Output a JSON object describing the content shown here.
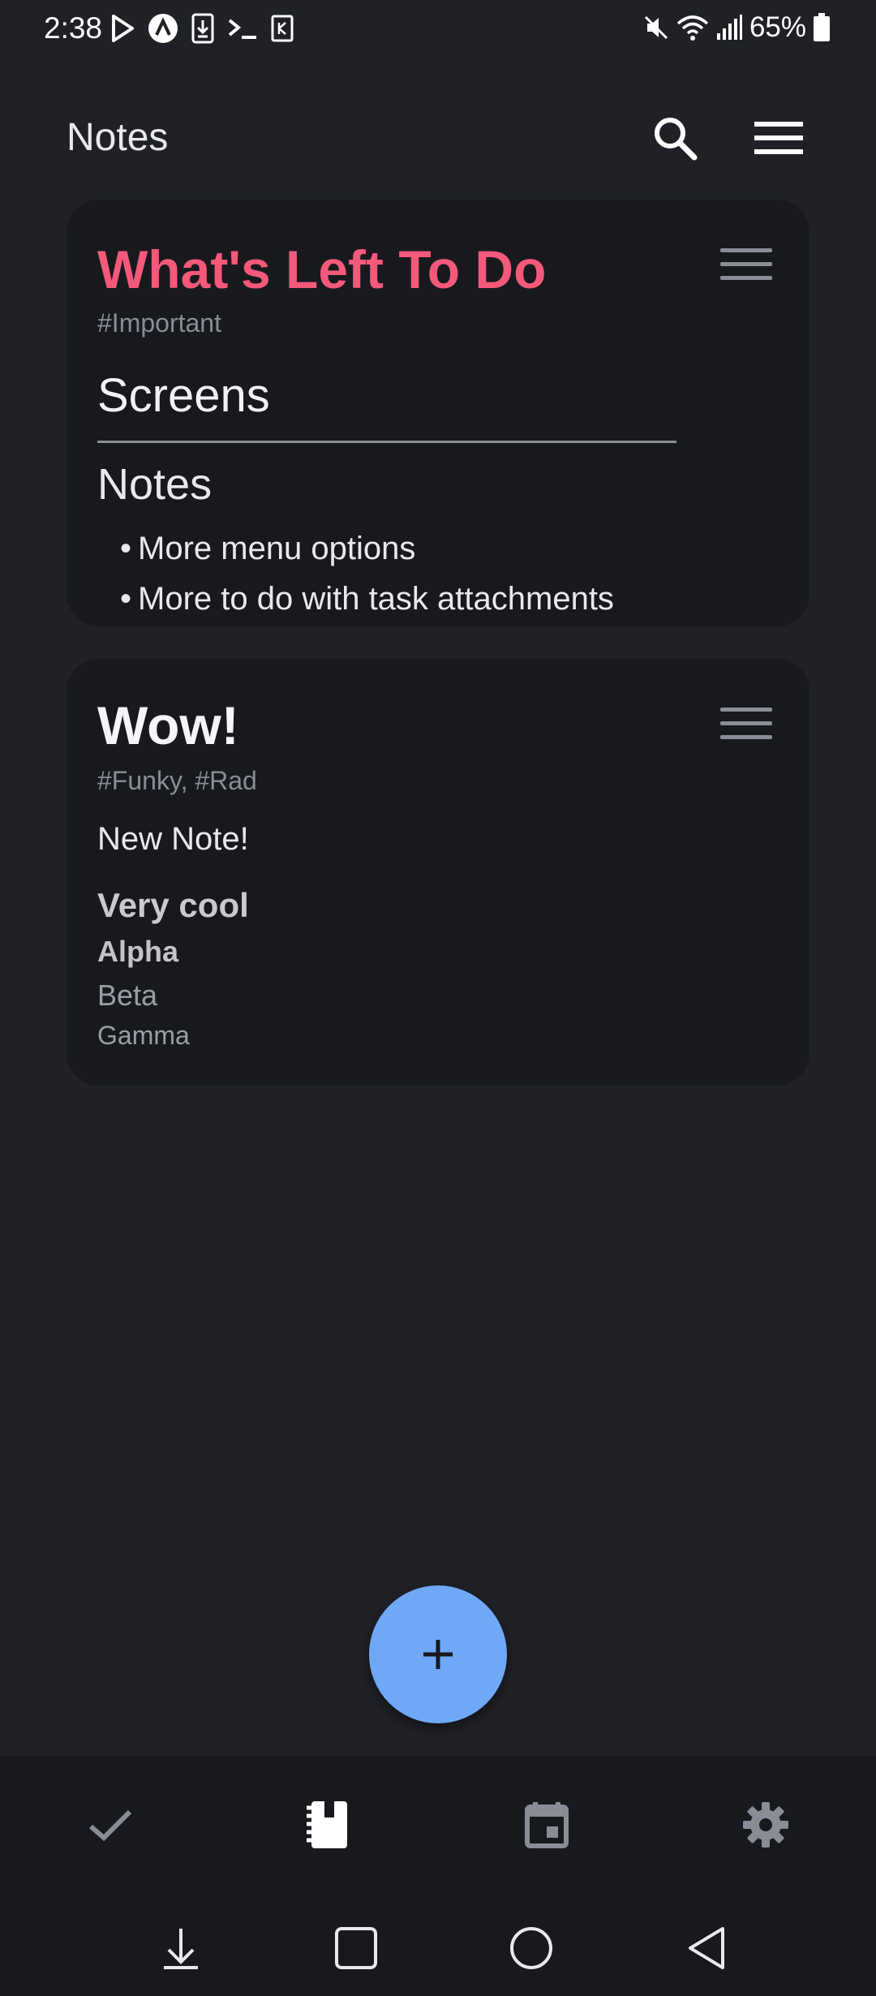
{
  "status_bar": {
    "time": "2:38",
    "battery_percent": "65%",
    "left_icons": [
      "play-store-icon",
      "app-icon",
      "download-icon",
      "terminal-icon",
      "k-icon"
    ],
    "right_icons": [
      "mute-icon",
      "wifi-icon",
      "signal-icon",
      "battery-icon"
    ]
  },
  "header": {
    "title": "Notes",
    "search_icon": "search-icon",
    "menu_icon": "hamburger-menu-icon"
  },
  "notes": [
    {
      "title": "What's Left To Do",
      "title_color": "#f4597a",
      "tags": "#Important",
      "heading": "Screens",
      "subheading": "Notes",
      "bullets": [
        "More menu options",
        "More to do with task attachments"
      ]
    },
    {
      "title": "Wow!",
      "tags": "#Funky, #Rad",
      "body": "New Note!",
      "heading_1": "Very cool",
      "heading_2": "Alpha",
      "heading_3": "Beta",
      "heading_4": "Gamma"
    }
  ],
  "fab": {
    "icon": "plus-icon",
    "color": "#6fa8f7"
  },
  "bottom_nav": {
    "items": [
      {
        "icon": "checkmark-icon",
        "active": false
      },
      {
        "icon": "notebook-icon",
        "active": true
      },
      {
        "icon": "calendar-icon",
        "active": false
      },
      {
        "icon": "gear-icon",
        "active": false
      }
    ]
  },
  "system_nav": {
    "items": [
      "download-arrow-icon",
      "recents-square-icon",
      "home-circle-icon",
      "back-triangle-icon"
    ]
  }
}
